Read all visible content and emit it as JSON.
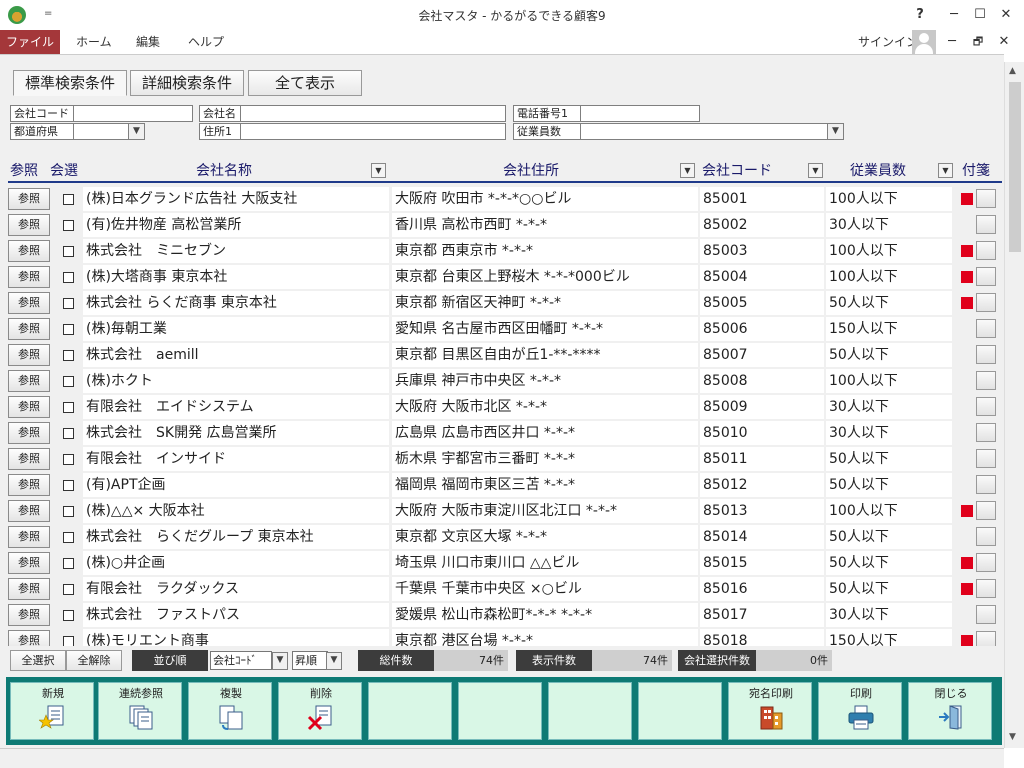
{
  "window": {
    "title": "会社マスタ - かるがるできる顧客9",
    "qat": "=",
    "help": "?",
    "minimize": "─",
    "maximize": "☐",
    "close": "✕"
  },
  "ribbon": {
    "tabs": [
      "ファイル",
      "ホーム",
      "編集",
      "ヘルプ"
    ],
    "signin": "サインイン",
    "restore_min": "─",
    "restore_max": "🗗",
    "restore_close": "✕"
  },
  "search_tabs": {
    "standard": "標準検索条件",
    "detail": "詳細検索条件",
    "show_all": "全て表示"
  },
  "filters": {
    "company_code": "会社コード",
    "company_name": "会社名",
    "phone": "電話番号1",
    "prefecture": "都道府県",
    "address": "住所1",
    "employees": "従業員数"
  },
  "columns": {
    "ref": "参照",
    "select": "会選",
    "name": "会社名称",
    "address": "会社住所",
    "code": "会社コード",
    "employees": "従業員数",
    "tag": "付箋"
  },
  "ref_label": "参照",
  "rows": [
    {
      "name": "(株)日本グランド広告社 大阪支社",
      "address": "大阪府 吹田市 *-*-*○○ビル",
      "code": "85001",
      "employees": "100人以下",
      "tag": true
    },
    {
      "name": "(有)佐井物産 高松営業所",
      "address": "香川県 高松市西町 *-*-*",
      "code": "85002",
      "employees": "30人以下",
      "tag": false
    },
    {
      "name": "株式会社　ミニセブン",
      "address": "東京都 西東京市 *-*-*",
      "code": "85003",
      "employees": "100人以下",
      "tag": true
    },
    {
      "name": "(株)大塔商事 東京本社",
      "address": "東京都 台東区上野桜木 *-*-*000ビル",
      "code": "85004",
      "employees": "100人以下",
      "tag": true
    },
    {
      "name": "株式会社 らくだ商事 東京本社",
      "address": "東京都 新宿区天神町 *-*-*",
      "code": "85005",
      "employees": "50人以下",
      "tag": true
    },
    {
      "name": "(株)毎朝工業",
      "address": "愛知県 名古屋市西区田幡町 *-*-*",
      "code": "85006",
      "employees": "150人以下",
      "tag": false
    },
    {
      "name": "株式会社　aemill",
      "address": "東京都 目黒区自由が丘1-**-****",
      "code": "85007",
      "employees": "50人以下",
      "tag": false
    },
    {
      "name": "(株)ホクト",
      "address": "兵庫県 神戸市中央区 *-*-*",
      "code": "85008",
      "employees": "100人以下",
      "tag": false
    },
    {
      "name": "有限会社　エイドシステム",
      "address": "大阪府 大阪市北区 *-*-*",
      "code": "85009",
      "employees": "30人以下",
      "tag": false
    },
    {
      "name": "株式会社　SK開発 広島営業所",
      "address": "広島県 広島市西区井口 *-*-*",
      "code": "85010",
      "employees": "30人以下",
      "tag": false
    },
    {
      "name": "有限会社　インサイド",
      "address": "栃木県 宇都宮市三番町 *-*-*",
      "code": "85011",
      "employees": "50人以下",
      "tag": false
    },
    {
      "name": "(有)APT企画",
      "address": "福岡県 福岡市東区三苫 *-*-*",
      "code": "85012",
      "employees": "50人以下",
      "tag": false
    },
    {
      "name": "(株)△△× 大阪本社",
      "address": "大阪府 大阪市東淀川区北江口 *-*-*",
      "code": "85013",
      "employees": "100人以下",
      "tag": true
    },
    {
      "name": "株式会社　らくだグループ 東京本社",
      "address": "東京都 文京区大塚 *-*-*",
      "code": "85014",
      "employees": "50人以下",
      "tag": false
    },
    {
      "name": "(株)○井企画",
      "address": "埼玉県 川口市東川口 △△ビル",
      "code": "85015",
      "employees": "50人以下",
      "tag": true
    },
    {
      "name": "有限会社　ラクダックス",
      "address": "千葉県 千葉市中央区 ×○ビル",
      "code": "85016",
      "employees": "50人以下",
      "tag": true
    },
    {
      "name": "株式会社　ファストパス",
      "address": "愛媛県 松山市森松町*-*-* *-*-*",
      "code": "85017",
      "employees": "30人以下",
      "tag": false
    },
    {
      "name": "(株)モリエント商事",
      "address": "東京都 港区台場 *-*-*",
      "code": "85018",
      "employees": "150人以下",
      "tag": true
    }
  ],
  "status": {
    "select_all": "全選択",
    "deselect_all": "全解除",
    "sort_label": "並び順",
    "sort_field": "会社ｺｰﾄﾞ",
    "sort_order": "昇順",
    "total_label": "総件数",
    "total_value": "74件",
    "shown_label": "表示件数",
    "shown_value": "74件",
    "selected_label": "会社選択件数",
    "selected_value": "0件"
  },
  "function_keys": [
    "新規",
    "連続参照",
    "複製",
    "削除",
    "",
    "",
    "",
    "",
    "宛名印刷",
    "印刷",
    "閉じる"
  ],
  "colors": {
    "file_tab": "#a4373a",
    "tag_red": "#e0001b",
    "fbar_bg": "#0e7a74",
    "fkey_bg": "#d9f7e6"
  }
}
